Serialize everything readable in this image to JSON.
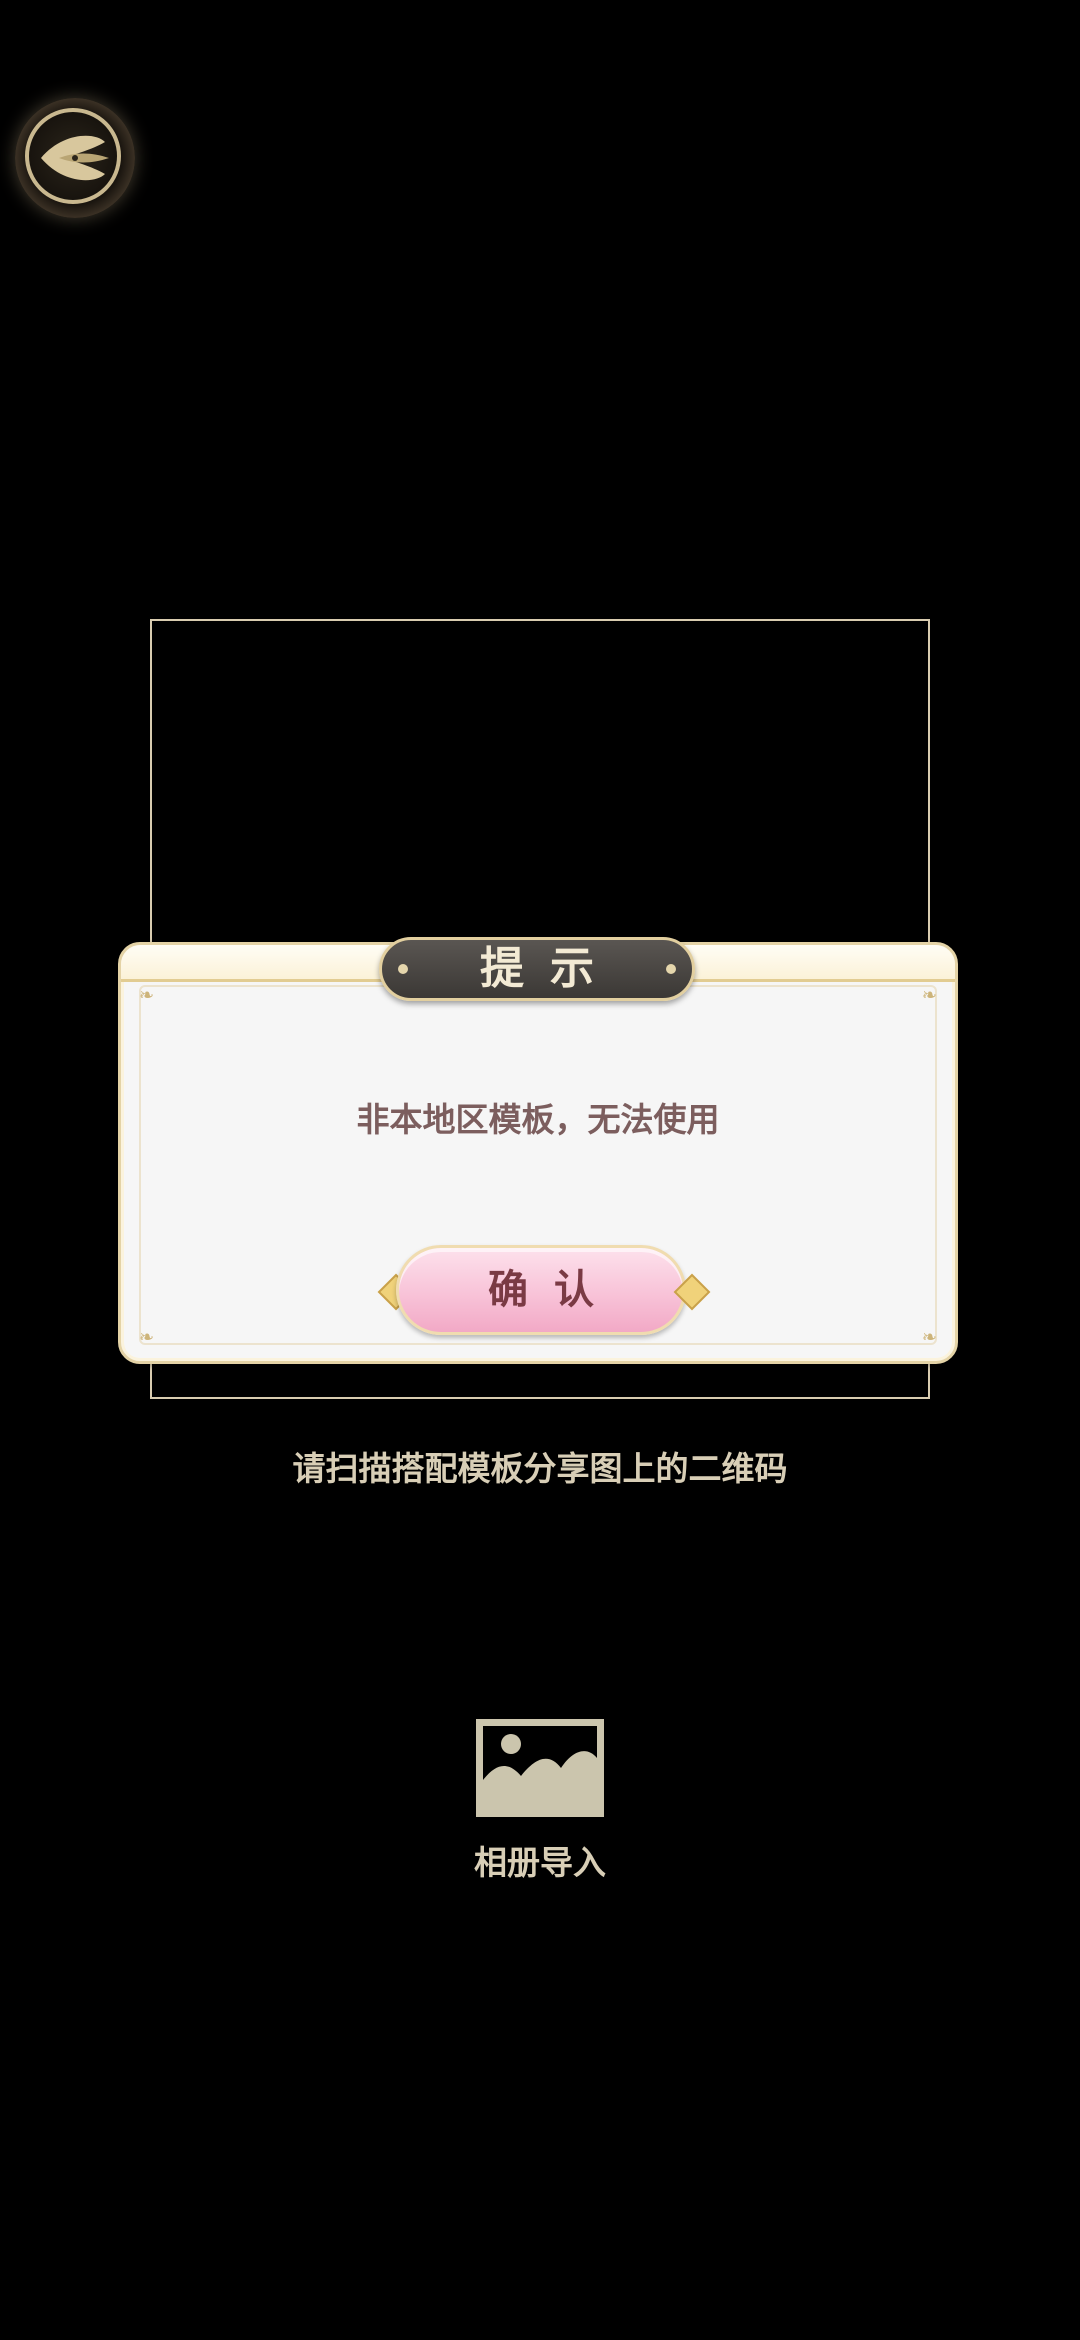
{
  "header": {
    "back_icon": "back-wing-icon"
  },
  "dialog": {
    "title": "提示",
    "message": "非本地区模板，无法使用",
    "confirm_label": "确认"
  },
  "scan": {
    "hint": "请扫描搭配模板分享图上的二维码"
  },
  "album": {
    "icon": "image-icon",
    "label": "相册导入"
  },
  "colors": {
    "background": "#000000",
    "frame": "#d9ccb0",
    "dialog_bg": "#f6f6f6",
    "gold": "#e2cf9f",
    "title_plate": "#4a4744",
    "button_pink": "#f8c3d8",
    "text_light": "#d8ceb6",
    "message_text": "#7c5e5e"
  }
}
